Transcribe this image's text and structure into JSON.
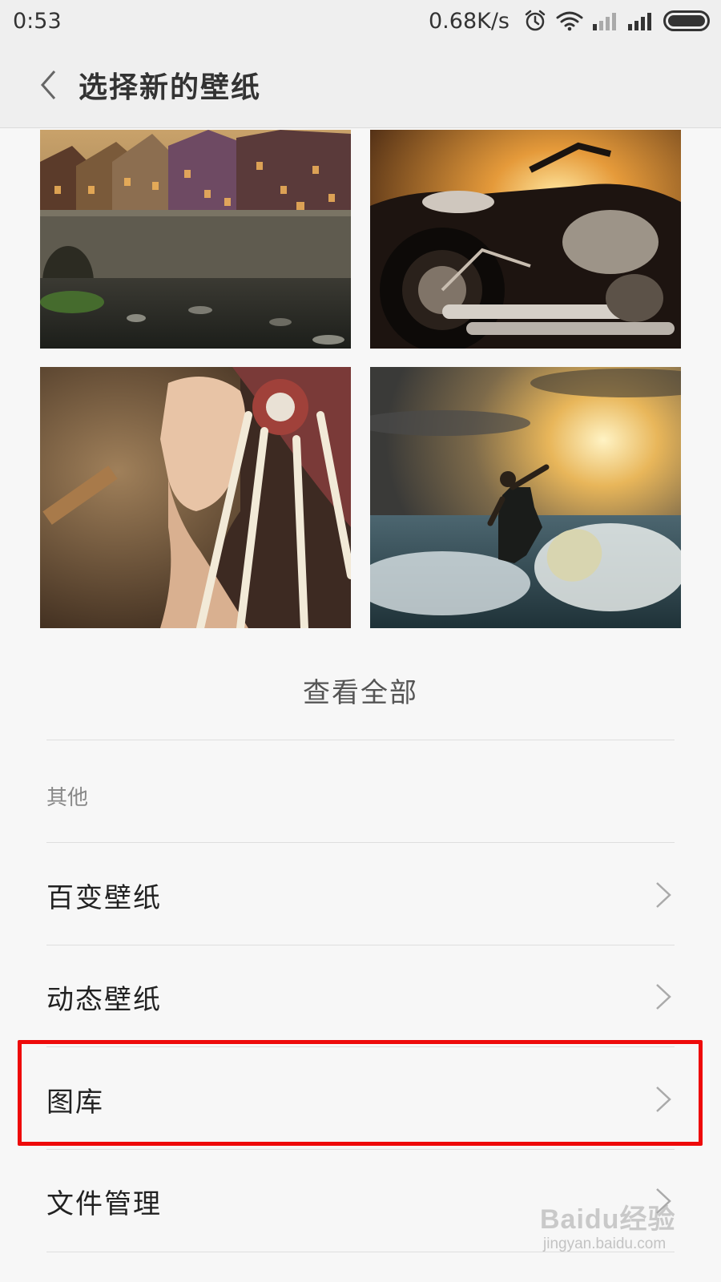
{
  "status_bar": {
    "time": "0:53",
    "network_speed": "0.68K/s",
    "icons": [
      "alarm-icon",
      "wifi-icon",
      "signal-icon-sim1",
      "signal-icon-sim2",
      "battery-icon"
    ]
  },
  "header": {
    "back_icon": "chevron-left-icon",
    "title": "选择新的壁纸"
  },
  "wallpapers": [
    {
      "subject": "village-by-river"
    },
    {
      "subject": "motorcycle-sunset"
    },
    {
      "subject": "woman-headdress"
    },
    {
      "subject": "surfer-sunset"
    }
  ],
  "view_all_label": "查看全部",
  "other_section": {
    "header": "其他",
    "items": [
      {
        "label": "百变壁纸"
      },
      {
        "label": "动态壁纸"
      },
      {
        "label": "图库"
      },
      {
        "label": "文件管理"
      }
    ]
  },
  "highlight": {
    "color": "#ee0a0a",
    "target": "图库"
  },
  "watermark": {
    "brand": "Baidu经验",
    "url": "jingyan.baidu.com"
  },
  "colors": {
    "background": "#f7f7f7",
    "header_bg": "#efefef",
    "divider": "#dedede"
  }
}
